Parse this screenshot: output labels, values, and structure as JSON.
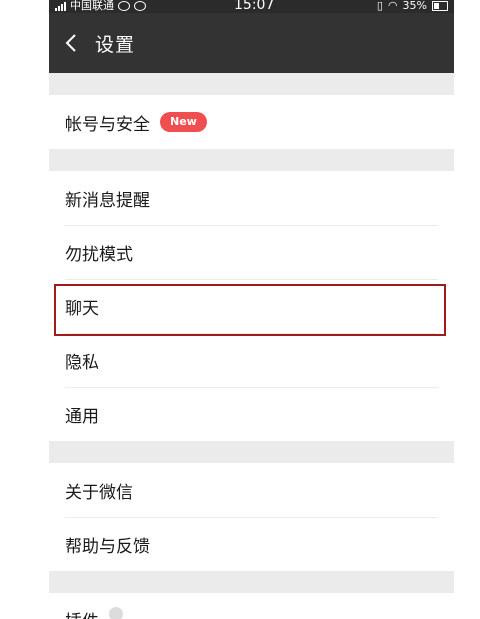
{
  "status_bar": {
    "carrier": "中国联通",
    "time": "15:07",
    "battery": "35%"
  },
  "header": {
    "title": "设置"
  },
  "groups": [
    {
      "items": [
        {
          "label": "帐号与安全",
          "badge": "New"
        }
      ]
    },
    {
      "items": [
        {
          "label": "新消息提醒"
        },
        {
          "label": "勿扰模式"
        },
        {
          "label": "聊天"
        },
        {
          "label": "隐私"
        },
        {
          "label": "通用"
        }
      ]
    },
    {
      "items": [
        {
          "label": "关于微信"
        },
        {
          "label": "帮助与反馈"
        }
      ]
    },
    {
      "items": [
        {
          "label": "插件"
        }
      ]
    }
  ],
  "highlight_item": "聊天",
  "colors": {
    "navbar": "#333333",
    "badge": "#f04f4f",
    "highlight_border": "#9e1c1c",
    "background": "#efeff4"
  }
}
